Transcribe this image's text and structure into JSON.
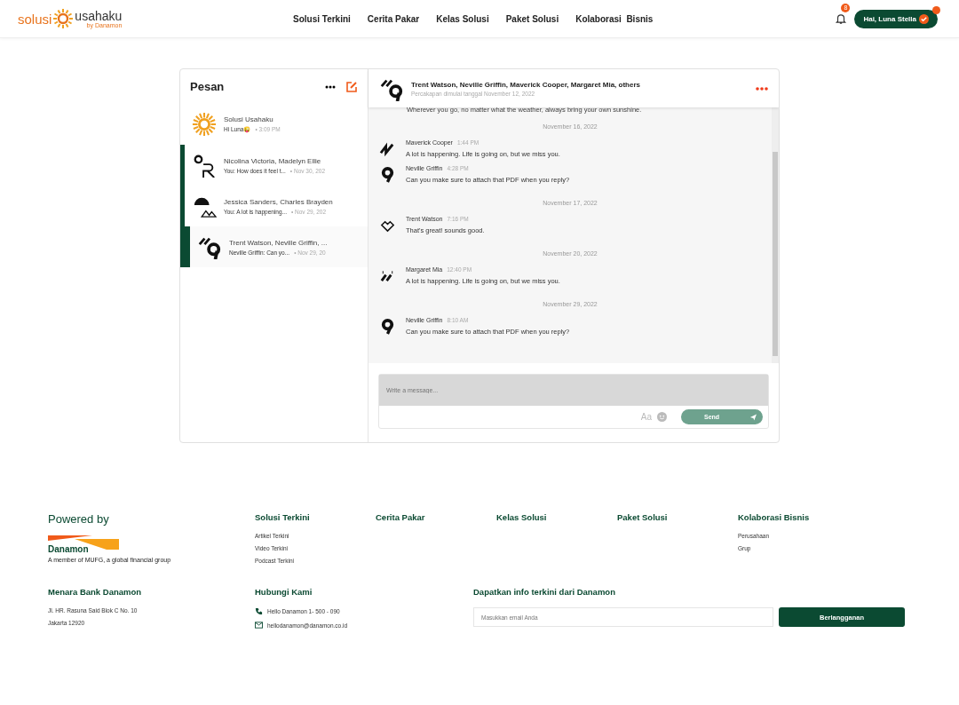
{
  "header": {
    "logo": {
      "left": "solusi",
      "right": "usahaku",
      "sub": "by Danamon"
    },
    "nav": [
      "Solusi Terkini",
      "Cerita Pakar",
      "Kelas Solusi",
      "Paket Solusi",
      "Kolaborasi  Bisnis"
    ],
    "notification_count": "8",
    "user_button": "Hai, Luna Stella"
  },
  "inbox": {
    "title": "Pesan",
    "conversations": [
      {
        "kind": "sun",
        "name": "Solusi Usahaku",
        "preview": "Hi Luna😜",
        "time": "• 3:09 PM",
        "selected": false,
        "unread": false
      },
      {
        "kind": "letters",
        "name": "Nicolina Victoria, Madelyn Ellie",
        "preview": "You: How does it feel t...",
        "time": "• Nov 30, 202",
        "selected": false,
        "unread": true
      },
      {
        "kind": "mountain",
        "name": "Jessica Sanders, Charles Brayden",
        "preview": "You: A lot is happening...",
        "time": "• Nov 29, 202",
        "selected": false,
        "unread": true
      },
      {
        "kind": "slash-pin",
        "name": "Trent Watson, Neville Griffin, ...",
        "preview": "Neville Griffin: Can yo...",
        "time": "• Nov 29, 20",
        "selected": true,
        "unread": false
      }
    ]
  },
  "chat": {
    "title": "Trent Watson, Neville Griffin, Maverick Cooper, Margaret Mia, others",
    "subtitle": "Percakapan dimulai tanggal November 12, 2022",
    "messages": [
      {
        "kind": "text",
        "text": "Wherever you go, no matter what the weather, always bring your own sunshine."
      },
      {
        "kind": "date",
        "text": "November 16, 2022"
      },
      {
        "kind": "message",
        "avatar": {
          "kind": "zigzag"
        },
        "name": "Maverick Cooper",
        "time": "1:44 PM",
        "text": "A lot is happening. Life is going on, but we miss you."
      },
      {
        "kind": "message",
        "avatar": {
          "kind": "pin"
        },
        "name": "Neville Griffin",
        "time": "4:28 PM",
        "text": "Can you make sure to attach that PDF when you reply?"
      },
      {
        "kind": "date",
        "text": "November 17, 2022"
      },
      {
        "kind": "message",
        "avatar": {
          "kind": "heart"
        },
        "name": "Trent Watson",
        "time": "7:16 PM",
        "text": "That's great! sounds good."
      },
      {
        "kind": "date",
        "text": "November 20, 2022"
      },
      {
        "kind": "message",
        "avatar": {
          "kind": "slashes"
        },
        "name": "Margaret Mia",
        "time": "12:40 PM",
        "text": "A lot is happening. Life is going on, but we miss you."
      },
      {
        "kind": "date",
        "text": "November 29, 2022"
      },
      {
        "kind": "message",
        "avatar": {
          "kind": "pin"
        },
        "name": "Neville Griffin",
        "time": "8:10 AM",
        "text": "Can you make sure to attach that PDF when you reply?"
      }
    ],
    "composer": {
      "placeholder": "Write a message...",
      "format_label": "Aa",
      "send": "Send"
    }
  },
  "footer": {
    "powered_by": "Powered by",
    "brand": "Danamon",
    "brand_tagline": "A member of MUFG, a global financial group",
    "columns": [
      {
        "title": "Solusi Terkini",
        "links": [
          "Artikel Terkini",
          "Video Terkini",
          "Podcast Terkini"
        ]
      },
      {
        "title": "Cerita Pakar"
      },
      {
        "title": "Kelas Solusi"
      },
      {
        "title": "Paket Solusi"
      },
      {
        "title": "Kolaborasi Bisnis",
        "links": [
          "Perusahaan",
          "Grup"
        ]
      }
    ],
    "address_title": "Menara Bank Danamon",
    "address": [
      "Jl. HR. Rasuna Said Blok C No. 10",
      "Jakarta 12920"
    ],
    "contact_title": "Hubungi Kami",
    "phone": "Hello Danamon 1- 500 - 090",
    "email": "hellodanamon@danamon.co.id",
    "subscribe_title": "Dapatkan info terkini dari Danamon",
    "email_placeholder": "Masukkan email Anda",
    "subscribe_button": "Berlangganan"
  }
}
